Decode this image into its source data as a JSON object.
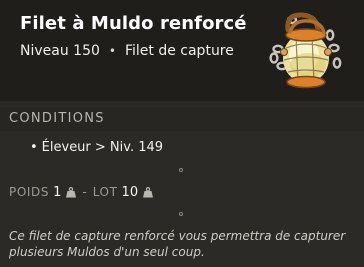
{
  "item": {
    "name": "Filet à Muldo renforcé",
    "level": "Niveau 150",
    "separator": "•",
    "category": "Filet de capture",
    "icon": "muldo-capture-net-icon"
  },
  "conditions": {
    "heading": "CONDITIONS",
    "bullet": "•",
    "items": [
      "Éleveur > Niv. 149"
    ]
  },
  "stats": {
    "weight_label": "POIDS",
    "weight_value": "1",
    "separator": "-",
    "lot_label": "LOT",
    "lot_value": "10",
    "weight_icon": "weight-icon"
  },
  "description": "Ce filet de capture renforcé vous permettra de capturer plusieurs Muldos d'un seul coup.",
  "colors": {
    "background": "#2b2a26",
    "header": "#1f1e1b",
    "title": "#ffffff",
    "muted": "#9c9a92"
  }
}
